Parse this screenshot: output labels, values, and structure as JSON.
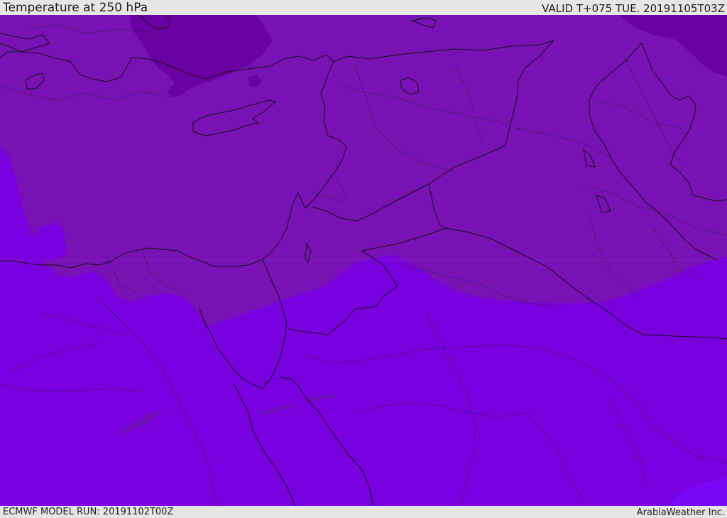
{
  "header": {
    "title": "Temperature at 250 hPa",
    "valid_time": "VALID T+075 TUE. 20191105T03Z"
  },
  "footer": {
    "model_run": "ECMWF MODEL RUN: 20191102T00Z",
    "credit": "ArabiaWeather Inc."
  },
  "map": {
    "colors": {
      "warm_band": "#7b00df",
      "mid_band": "#7812b4",
      "cold_band": "#6b00a3",
      "warmest_band": "#7a08f8",
      "coastline": "#111111"
    }
  }
}
